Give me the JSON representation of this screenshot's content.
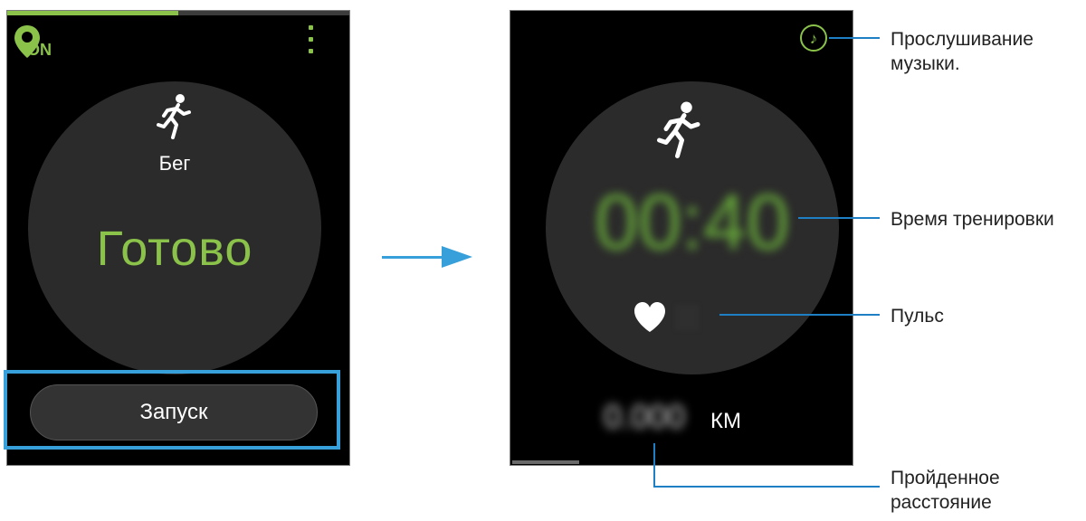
{
  "left_screen": {
    "gps_status": "ON",
    "gps_icon": "location-pin-icon",
    "menu_icon": "more-vertical-icon",
    "progress": 0.5,
    "activity_icon": "running-icon",
    "activity_label": "Бег",
    "status_text": "Готово",
    "start_button_label": "Запуск"
  },
  "arrow_icon": "arrow-right-icon",
  "right_screen": {
    "music_icon": "music-note-icon",
    "activity_icon": "running-icon",
    "workout_time": "00:40",
    "heart_icon": "heart-icon",
    "distance_value": "0.000",
    "distance_unit": "КМ"
  },
  "callouts": {
    "music": "Прослушивание музыки.",
    "workout_time": "Время тренировки",
    "pulse": "Пульс",
    "distance": "Пройденное расстояние"
  },
  "colors": {
    "accent_green": "#8bc34a",
    "highlight_blue": "#37a0db",
    "callout_blue": "#1f7fc4",
    "screen_bg": "#000000",
    "circle_bg": "#2b2b2b"
  }
}
